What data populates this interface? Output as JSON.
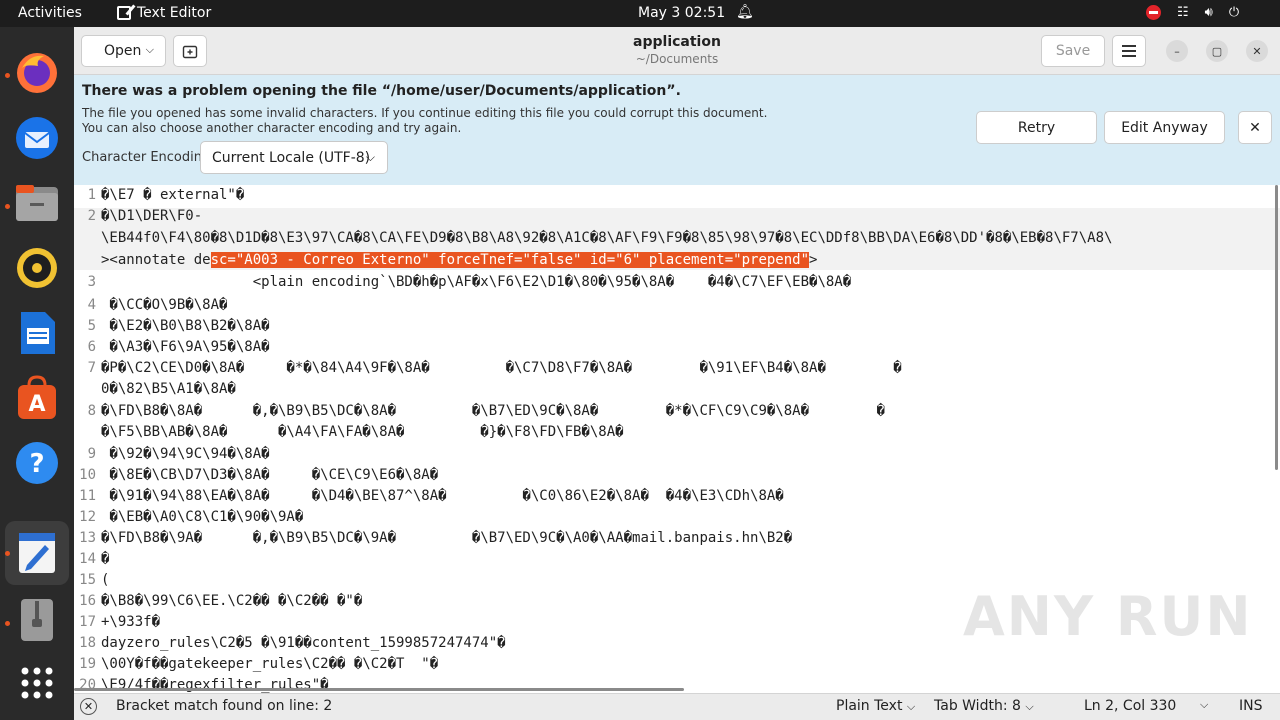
{
  "topbar": {
    "activities": "Activities",
    "app_name": "Text Editor",
    "clock": "May 3  02:51"
  },
  "dock": {
    "apps": [
      {
        "name": "firefox-icon"
      },
      {
        "name": "thunderbird-icon"
      },
      {
        "name": "files-icon"
      },
      {
        "name": "rhythmbox-icon"
      },
      {
        "name": "libreoffice-writer-icon"
      },
      {
        "name": "app-center-icon"
      },
      {
        "name": "help-icon"
      },
      {
        "name": "text-editor-icon"
      },
      {
        "name": "archive-icon"
      },
      {
        "name": "show-apps-icon"
      }
    ]
  },
  "header": {
    "open_label": "Open",
    "title": "application",
    "subtitle": "~/Documents",
    "save_label": "Save"
  },
  "infobar": {
    "heading": "There was a problem opening the file “/home/user/Documents/application”.",
    "message_line1": "The file you opened has some invalid characters. If you continue editing this file you could corrupt this document.",
    "message_line2": "You can also choose another character encoding and try again.",
    "encoding_label": "Character Encoding:",
    "encoding_value": "Current Locale (UTF-8)",
    "retry_label": "Retry",
    "edit_anyway_label": "Edit Anyway"
  },
  "editor": {
    "line_numbers": [
      "1",
      "2",
      "3",
      "4",
      "5",
      "6",
      "7",
      "8",
      "9",
      "10",
      "11",
      "12",
      "13",
      "14",
      "15",
      "16",
      "17",
      "18",
      "19",
      "20"
    ],
    "lines": [
      "�\\E7 � external\"�",
      "�\\D1\\DER\\F0-",
      "\\EB44f0\\F4\\80�8\\D1D�8\\E3\\97\\CA�8\\CA\\FE\\D9�8\\B8\\A8\\92�8\\A1C�8\\AF\\F9\\F9�8\\85\\98\\97�8\\EC\\DDf8\\BB\\DA\\E6�8\\DD'�8�\\EB�8\\F7\\A8\\",
      "><annotate de",
      "sc=\"A003 - Correo Externo\" forceTnef=\"false\" id=\"6\" placement=\"prepend\"",
      ">",
      "                  <plain encoding`\\BD�h�p\\AF�x\\F6\\E2\\D1�\\80�\\95�\\8A�    �4�\\C7\\EF\\EB�\\8A�",
      " �\\CC�O\\9B�\\8A�",
      " �\\E2�\\B0\\B8\\B2�\\8A�",
      " �\\A3�\\F6\\9A\\95�\\8A�",
      "�P�\\C2\\CE\\D0�\\8A�     �*�\\84\\A4\\9F�\\8A�         �\\C7\\D8\\F7�\\8A�        �\\91\\EF\\B4�\\8A�        �",
      "0�\\82\\B5\\A1�\\8A�",
      "�\\FD\\B8�\\8A�      �,�\\B9\\B5\\DC�\\8A�         �\\B7\\ED\\9C�\\8A�        �*�\\CF\\C9\\C9�\\8A�        �",
      "�\\F5\\BB\\AB�\\8A�      �\\A4\\FA\\FA�\\8A�         �}�\\F8\\FD\\FB�\\8A�",
      " �\\92�\\94\\9C\\94�\\8A�",
      " �\\8E�\\CB\\D7\\D3�\\8A�     �\\CE\\C9\\E6�\\8A�",
      " �\\91�\\94\\88\\EA�\\8A�     �\\D4�\\BE\\87^\\8A�         �\\C0\\86\\E2�\\8A�  �4�\\E3\\CDh\\8A�",
      " �\\EB�\\A0\\C8\\C1�\\90�\\9A�",
      "�\\FD\\B8�\\9A�      �,�\\B9\\B5\\DC�\\9A�         �\\B7\\ED\\9C�\\A0�\\AA�mail.banpais.hn\\B2�",
      "�",
      "(",
      "�\\B8�\\99\\C6\\EE.\\C2�� �\\C2�� �\"�",
      "+\\933f�",
      "dayzero_rules\\C2�5 �\\91��content_1599857247474\"�",
      "\\00Y�f��gatekeeper_rules\\C2�� �\\C2�T  \"�",
      "\\E9/4f��regexfilter_rules\"�"
    ]
  },
  "status": {
    "message": "Bracket match found on line: 2",
    "language": "Plain Text",
    "tab_width": "Tab Width: 8",
    "position": "Ln 2, Col 330",
    "mode": "INS"
  },
  "watermark": "ANY RUN",
  "colors": {
    "selection": "#e95420",
    "infobar_bg": "#d8ecf6",
    "dock_bg": "#2a2a2a"
  }
}
